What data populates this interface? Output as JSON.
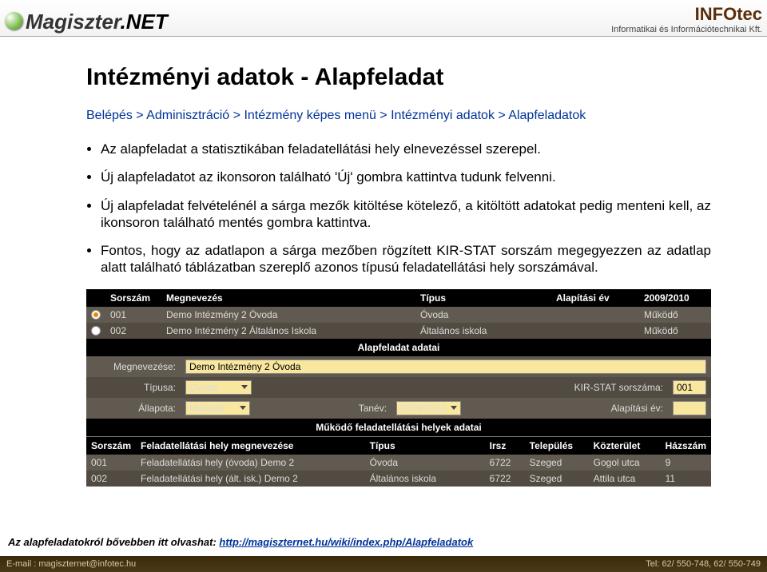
{
  "header": {
    "brand_left": "Magiszter",
    "brand_right": ".NET",
    "company": "INFOtec",
    "company_sub": "Informatikai és Információtechnikai Kft."
  },
  "title": "Intézményi adatok - Alapfeladat",
  "breadcrumb": "Belépés > Adminisztráció > Intézmény képes menü > Intézményi adatok > Alapfeladatok",
  "bullets": [
    "Az alapfeladat a statisztikában feladatellátási hely elnevezéssel szerepel.",
    "Új alapfeladatot az ikonsoron található 'Új' gombra kattintva tudunk felvenni.",
    "Új alapfeladat felvételénél a sárga mezők kitöltése kötelező, a kitöltött adatokat pedig menteni kell, az ikonsoron található mentés gombra kattintva.",
    "Fontos, hogy az adatlapon a sárga mezőben rögzített KIR-STAT sorszám megegyezzen az adatlap alatt található táblázatban szereplő azonos típusú feladatellátási hely sorszámával."
  ],
  "list_headers": {
    "sorszam": "Sorszám",
    "megnevezes": "Megnevezés",
    "tipus": "Típus",
    "alapitasi_ev": "Alapítási év",
    "tanev": "2009/2010"
  },
  "list_rows": [
    {
      "selected": true,
      "sorszam": "001",
      "megnevezes": "Demo Intézmény 2 Óvoda",
      "tipus": "Óvoda",
      "alapitasi": "",
      "allapot": "Működő"
    },
    {
      "selected": false,
      "sorszam": "002",
      "megnevezes": "Demo Intézmény 2 Általános Iskola",
      "tipus": "Általános iskola",
      "alapitasi": "",
      "allapot": "Működő"
    }
  ],
  "section_title_1": "Alapfeladat adatai",
  "form": {
    "megnevezes_lbl": "Megnevezése:",
    "megnevezes_val": "Demo Intézmény 2 Óvoda",
    "tipus_lbl": "Típusa:",
    "tipus_val": "Óvoda",
    "kirstat_lbl": "KIR-STAT sorszáma:",
    "kirstat_val": "001",
    "allapot_lbl": "Állapota:",
    "allapot_val": "Működő",
    "tanev_lbl": "Tanév:",
    "tanev_val": "2009/2010",
    "alapitasi_lbl": "Alapítási év:",
    "alapitasi_val": ""
  },
  "section_title_2": "Működő feladatellátási helyek adatai",
  "sub_headers": {
    "sorszam": "Sorszám",
    "megnevezes": "Feladatellátási hely megnevezése",
    "tipus": "Típus",
    "irsz": "Irsz",
    "telepules": "Település",
    "kozterulet": "Közterület",
    "hazszam": "Házszám"
  },
  "sub_rows": [
    {
      "sorszam": "001",
      "megnevezes": "Feladatellátási hely (óvoda) Demo 2",
      "tipus": "Óvoda",
      "irsz": "6722",
      "telepules": "Szeged",
      "kozterulet": "Gogol utca",
      "hazszam": "9"
    },
    {
      "sorszam": "002",
      "megnevezes": "Feladatellátási hely (ált. isk.) Demo 2",
      "tipus": "Általános iskola",
      "irsz": "6722",
      "telepules": "Szeged",
      "kozterulet": "Attila utca",
      "hazszam": "11"
    }
  ],
  "footnote": {
    "text": "Az alapfeladatokról bővebben itt olvashat: ",
    "link": "http://magiszternet.hu/wiki/index.php/Alapfeladatok"
  },
  "footer": {
    "left": "E-mail : magiszternet@infotec.hu",
    "right": "Tel: 62/ 550-748, 62/ 550-749"
  }
}
